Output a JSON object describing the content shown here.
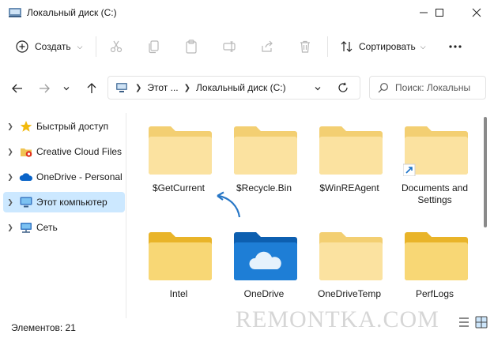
{
  "window": {
    "title": "Локальный диск (C:)",
    "icons": {
      "app": "drive-icon",
      "minimize": "minimize-icon",
      "maximize": "maximize-icon",
      "close": "close-icon"
    }
  },
  "toolbar": {
    "new_label": "Создать",
    "sort_label": "Сортировать",
    "icons": [
      "cut-icon",
      "copy-icon",
      "paste-icon",
      "rename-icon",
      "share-icon",
      "delete-icon"
    ]
  },
  "address": {
    "segments": [
      "Этот ...",
      "Локальный диск (C:)"
    ],
    "search_placeholder": "Поиск: Локальны"
  },
  "sidebar": {
    "items": [
      {
        "label": "Быстрый доступ",
        "icon": "star-icon"
      },
      {
        "label": "Creative Cloud Files",
        "icon": "creative-cloud-icon"
      },
      {
        "label": "OneDrive - Personal",
        "icon": "onedrive-cloud-icon"
      },
      {
        "label": "Этот компьютер",
        "icon": "computer-icon",
        "selected": true
      },
      {
        "label": "Сеть",
        "icon": "network-icon"
      }
    ]
  },
  "files": [
    {
      "name": "$GetCurrent",
      "type": "folder-light"
    },
    {
      "name": "$Recycle.Bin",
      "type": "folder-light"
    },
    {
      "name": "$WinREAgent",
      "type": "folder-light"
    },
    {
      "name": "Documents and Settings",
      "type": "folder-shortcut"
    },
    {
      "name": "Intel",
      "type": "folder"
    },
    {
      "name": "OneDrive",
      "type": "folder-onedrive"
    },
    {
      "name": "OneDriveTemp",
      "type": "folder-light"
    },
    {
      "name": "PerfLogs",
      "type": "folder"
    }
  ],
  "status": {
    "items_count": "Элементов: 21"
  },
  "watermark": "REMONTKA.COM",
  "colors": {
    "accent": "#0067c0",
    "selection": "#cce8ff",
    "folder": "#f8d775",
    "folder_dark": "#e9b429",
    "onedrive_folder": "#1e7ed6"
  }
}
